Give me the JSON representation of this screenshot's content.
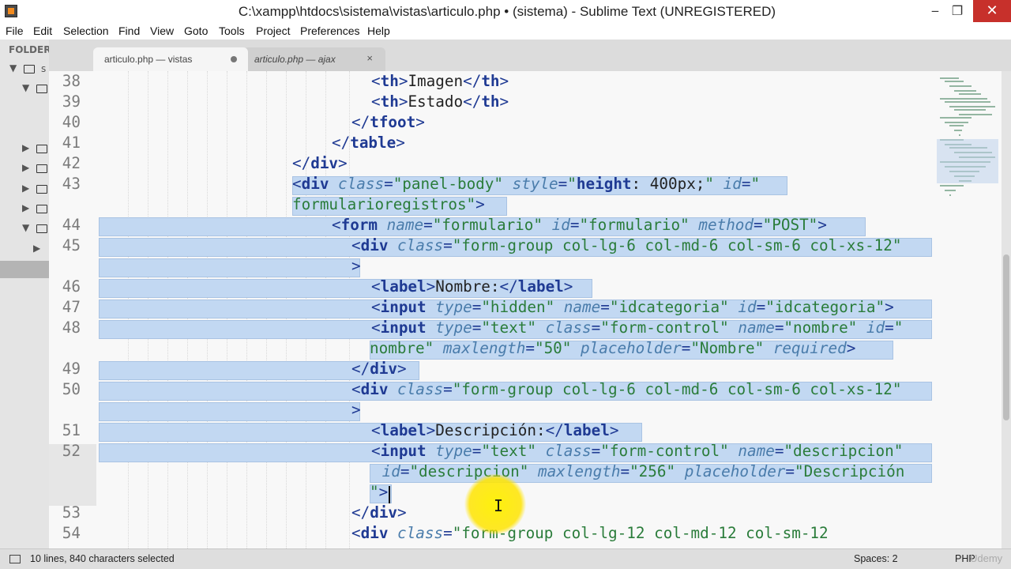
{
  "window": {
    "title": "C:\\xampp\\htdocs\\sistema\\vistas\\articulo.php • (sistema) - Sublime Text (UNREGISTERED)",
    "minimize_glyph": "‒",
    "maximize_glyph": "❐",
    "close_glyph": "✕"
  },
  "menu": [
    "File",
    "Edit",
    "Selection",
    "Find",
    "View",
    "Goto",
    "Tools",
    "Project",
    "Preferences",
    "Help"
  ],
  "sidebar": {
    "title": "FOLDER",
    "root_label": "s"
  },
  "tabs": [
    {
      "label": "articulo.php — vistas",
      "state": "modified",
      "active": true
    },
    {
      "label": "articulo.php — ajax",
      "state": "close",
      "active": false
    }
  ],
  "tab_close_glyph": "×",
  "editor": {
    "lines": [
      {
        "n": "38",
        "parts": [
          [
            "pn",
            "<"
          ],
          [
            "tag",
            "th"
          ],
          [
            "pn",
            ">"
          ],
          [
            "txt",
            "Imagen"
          ],
          [
            "pn",
            "</"
          ],
          [
            "tag",
            "th"
          ],
          [
            "pn",
            ">"
          ]
        ]
      },
      {
        "n": "39",
        "parts": [
          [
            "pn",
            "<"
          ],
          [
            "tag",
            "th"
          ],
          [
            "pn",
            ">"
          ],
          [
            "txt",
            "Estado"
          ],
          [
            "pn",
            "</"
          ],
          [
            "tag",
            "th"
          ],
          [
            "pn",
            ">"
          ]
        ]
      },
      {
        "n": "40",
        "parts": [
          [
            "pn",
            "</"
          ],
          [
            "tag",
            "tfoot"
          ],
          [
            "pn",
            ">"
          ]
        ]
      },
      {
        "n": "41",
        "parts": [
          [
            "pn",
            "</"
          ],
          [
            "tag",
            "table"
          ],
          [
            "pn",
            ">"
          ]
        ]
      },
      {
        "n": "42",
        "parts": [
          [
            "pn",
            "</"
          ],
          [
            "tag",
            "div"
          ],
          [
            "pn",
            ">"
          ]
        ]
      },
      {
        "n": "43",
        "parts": [
          [
            "pn",
            "<"
          ],
          [
            "tag",
            "div"
          ],
          [
            "txt",
            " "
          ],
          [
            "attr",
            "class"
          ],
          [
            "pn",
            "="
          ],
          [
            "str",
            "\"panel-body\""
          ],
          [
            "txt",
            " "
          ],
          [
            "attr",
            "style"
          ],
          [
            "pn",
            "="
          ],
          [
            "str",
            "\""
          ],
          [
            "cssprop",
            "height"
          ],
          [
            "cssval",
            ": 400px;"
          ],
          [
            "str",
            "\""
          ],
          [
            "txt",
            " "
          ],
          [
            "attr",
            "id"
          ],
          [
            "pn",
            "="
          ],
          [
            "str",
            "\""
          ]
        ]
      },
      {
        "n": "",
        "parts": [
          [
            "str",
            "formularioregistros\""
          ],
          [
            "pn",
            ">"
          ]
        ]
      },
      {
        "n": "44",
        "parts": [
          [
            "pn",
            "<"
          ],
          [
            "tag",
            "form"
          ],
          [
            "txt",
            " "
          ],
          [
            "attr",
            "name"
          ],
          [
            "pn",
            "="
          ],
          [
            "str",
            "\"formulario\""
          ],
          [
            "txt",
            " "
          ],
          [
            "attr",
            "id"
          ],
          [
            "pn",
            "="
          ],
          [
            "str",
            "\"formulario\""
          ],
          [
            "txt",
            " "
          ],
          [
            "attr",
            "method"
          ],
          [
            "pn",
            "="
          ],
          [
            "str",
            "\"POST\""
          ],
          [
            "pn",
            ">"
          ]
        ]
      },
      {
        "n": "45",
        "parts": [
          [
            "pn",
            "<"
          ],
          [
            "tag",
            "div"
          ],
          [
            "txt",
            " "
          ],
          [
            "attr",
            "class"
          ],
          [
            "pn",
            "="
          ],
          [
            "str",
            "\"form-group col-lg-6 col-md-6 col-sm-6 col-xs-12\""
          ]
        ]
      },
      {
        "n": "",
        "parts": [
          [
            "pn",
            ">"
          ]
        ]
      },
      {
        "n": "46",
        "parts": [
          [
            "pn",
            "<"
          ],
          [
            "tag",
            "label"
          ],
          [
            "pn",
            ">"
          ],
          [
            "txt",
            "Nombre:"
          ],
          [
            "pn",
            "</"
          ],
          [
            "tag",
            "label"
          ],
          [
            "pn",
            ">"
          ]
        ]
      },
      {
        "n": "47",
        "parts": [
          [
            "pn",
            "<"
          ],
          [
            "tag",
            "input"
          ],
          [
            "txt",
            " "
          ],
          [
            "attr",
            "type"
          ],
          [
            "pn",
            "="
          ],
          [
            "str",
            "\"hidden\""
          ],
          [
            "txt",
            " "
          ],
          [
            "attr",
            "name"
          ],
          [
            "pn",
            "="
          ],
          [
            "str",
            "\"idcategoria\""
          ],
          [
            "txt",
            " "
          ],
          [
            "attr",
            "id"
          ],
          [
            "pn",
            "="
          ],
          [
            "str",
            "\"idcategoria\""
          ],
          [
            "pn",
            ">"
          ]
        ]
      },
      {
        "n": "48",
        "parts": [
          [
            "pn",
            "<"
          ],
          [
            "tag",
            "input"
          ],
          [
            "txt",
            " "
          ],
          [
            "attr",
            "type"
          ],
          [
            "pn",
            "="
          ],
          [
            "str",
            "\"text\""
          ],
          [
            "txt",
            " "
          ],
          [
            "attr",
            "class"
          ],
          [
            "pn",
            "="
          ],
          [
            "str",
            "\"form-control\""
          ],
          [
            "txt",
            " "
          ],
          [
            "attr",
            "name"
          ],
          [
            "pn",
            "="
          ],
          [
            "str",
            "\"nombre\""
          ],
          [
            "txt",
            " "
          ],
          [
            "attr",
            "id"
          ],
          [
            "pn",
            "="
          ],
          [
            "str",
            "\""
          ]
        ]
      },
      {
        "n": "",
        "parts": [
          [
            "str",
            "nombre\""
          ],
          [
            "txt",
            " "
          ],
          [
            "attr",
            "maxlength"
          ],
          [
            "pn",
            "="
          ],
          [
            "str",
            "\"50\""
          ],
          [
            "txt",
            " "
          ],
          [
            "attr",
            "placeholder"
          ],
          [
            "pn",
            "="
          ],
          [
            "str",
            "\"Nombre\""
          ],
          [
            "txt",
            " "
          ],
          [
            "attr",
            "required"
          ],
          [
            "pn",
            ">"
          ]
        ]
      },
      {
        "n": "49",
        "parts": [
          [
            "pn",
            "</"
          ],
          [
            "tag",
            "div"
          ],
          [
            "pn",
            ">"
          ]
        ]
      },
      {
        "n": "50",
        "parts": [
          [
            "pn",
            "<"
          ],
          [
            "tag",
            "div"
          ],
          [
            "txt",
            " "
          ],
          [
            "attr",
            "class"
          ],
          [
            "pn",
            "="
          ],
          [
            "str",
            "\"form-group col-lg-6 col-md-6 col-sm-6 col-xs-12\""
          ]
        ]
      },
      {
        "n": "",
        "parts": [
          [
            "pn",
            ">"
          ]
        ]
      },
      {
        "n": "51",
        "parts": [
          [
            "pn",
            "<"
          ],
          [
            "tag",
            "label"
          ],
          [
            "pn",
            ">"
          ],
          [
            "txt",
            "Descripción:"
          ],
          [
            "pn",
            "</"
          ],
          [
            "tag",
            "label"
          ],
          [
            "pn",
            ">"
          ]
        ]
      },
      {
        "n": "52",
        "parts": [
          [
            "pn",
            "<"
          ],
          [
            "tag",
            "input"
          ],
          [
            "txt",
            " "
          ],
          [
            "attr",
            "type"
          ],
          [
            "pn",
            "="
          ],
          [
            "str",
            "\"text\""
          ],
          [
            "txt",
            " "
          ],
          [
            "attr",
            "class"
          ],
          [
            "pn",
            "="
          ],
          [
            "str",
            "\"form-control\""
          ],
          [
            "txt",
            " "
          ],
          [
            "attr",
            "name"
          ],
          [
            "pn",
            "="
          ],
          [
            "str",
            "\"descripcion\""
          ]
        ]
      },
      {
        "n": "",
        "parts": [
          [
            "txt",
            " "
          ],
          [
            "attr",
            "id"
          ],
          [
            "pn",
            "="
          ],
          [
            "str",
            "\"descripcion\""
          ],
          [
            "txt",
            " "
          ],
          [
            "attr",
            "maxlength"
          ],
          [
            "pn",
            "="
          ],
          [
            "str",
            "\"256\""
          ],
          [
            "txt",
            " "
          ],
          [
            "attr",
            "placeholder"
          ],
          [
            "pn",
            "="
          ],
          [
            "str",
            "\"Descripción"
          ]
        ]
      },
      {
        "n": "",
        "parts": [
          [
            "str",
            "\""
          ],
          [
            "pn",
            ">"
          ]
        ]
      },
      {
        "n": "53",
        "parts": [
          [
            "pn",
            "</"
          ],
          [
            "tag",
            "div"
          ],
          [
            "pn",
            ">"
          ]
        ]
      },
      {
        "n": "54",
        "parts": [
          [
            "pn",
            "<"
          ],
          [
            "tag",
            "div"
          ],
          [
            "txt",
            " "
          ],
          [
            "attr",
            "class"
          ],
          [
            "pn",
            "="
          ],
          [
            "str",
            "\"form-group col-lg-12 col-md-12 col-sm-12"
          ]
        ]
      }
    ]
  },
  "status": {
    "selection": "10 lines, 840 characters selected",
    "indent": "Spaces: 2",
    "syntax": "PHP",
    "watermark": "Udemy"
  },
  "colors": {
    "selection": "#c2d8f2",
    "tag": "#1f3a93",
    "attribute": "#4a7cab",
    "string": "#2a7c3a",
    "close_button": "#c7302b",
    "highlight": "#ffe600"
  }
}
